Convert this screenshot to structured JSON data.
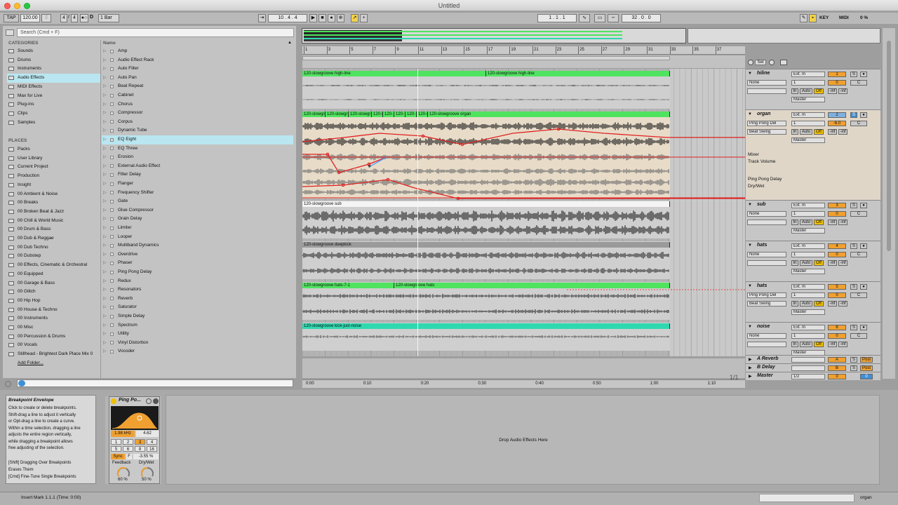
{
  "window": {
    "title": "Untitled"
  },
  "control_bar": {
    "tap": "TAP",
    "tempo": "120.00",
    "signature_num": "4",
    "signature_den": "4",
    "quantize": "1 Bar",
    "position": "10 . 4 . 4",
    "loop_start": "1 . 1 . 1",
    "loop_length": "32 . 0 . 0",
    "key": "KEY",
    "midi": "MIDI",
    "cpu": "0 %",
    "d_label": "D"
  },
  "browser": {
    "search_placeholder": "Search (Cmd + F)",
    "categories_header": "CATEGORIES",
    "categories": [
      "Sounds",
      "Drums",
      "Instruments",
      "Audio Effects",
      "MIDI Effects",
      "Max for Live",
      "Plug-ins",
      "Clips",
      "Samples"
    ],
    "places_header": "PLACES",
    "places": [
      "Packs",
      "User Library",
      "Current Project",
      "Production",
      "Insight",
      "00 Ambient & Noise",
      "00 Breaks",
      "00 Broken Beat & Jazz",
      "00 Chill & World Music",
      "00 Drum & Bass",
      "00 Dub & Reggae",
      "00 Dub Techno",
      "00 Dubstep",
      "00 Effects, Cinematic & Orchestral",
      "00 Equipped",
      "00 Garage & Bass",
      "00 Glitch",
      "00 Hip Hop",
      "00 House & Techno",
      "00 Instruments",
      "00 Misc",
      "00 Percussion & Drums",
      "00 Vocals",
      "Stillhead - Brightest Dark Place Mix 0"
    ],
    "add_folder": "Add Folder...",
    "name_header": "Name",
    "devices": [
      "Amp",
      "Audio Effect Rack",
      "Auto Filter",
      "Auto Pan",
      "Beat Repeat",
      "Cabinet",
      "Chorus",
      "Compressor",
      "Corpus",
      "Dynamic Tube",
      "EQ Eight",
      "EQ Three",
      "Erosion",
      "External Audio Effect",
      "Filter Delay",
      "Flanger",
      "Frequency Shifter",
      "Gate",
      "Glue Compressor",
      "Grain Delay",
      "Limiter",
      "Looper",
      "Multiband Dynamics",
      "Overdrive",
      "Phaser",
      "Ping Pong Delay",
      "Redux",
      "Resonators",
      "Reverb",
      "Saturator",
      "Simple Delay",
      "Spectrum",
      "Utility",
      "Vinyl Distortion",
      "Vocoder"
    ]
  },
  "ruler": {
    "bars": [
      "1",
      "3",
      "5",
      "7",
      "9",
      "11",
      "13",
      "15",
      "17",
      "19",
      "21",
      "23",
      "25",
      "27",
      "29",
      "31",
      "33",
      "35",
      "37"
    ],
    "times": [
      "0:00",
      "0:10",
      "0:20",
      "0:30",
      "0:40",
      "0:50",
      "1:00",
      "1:10"
    ],
    "set_label": "Set",
    "page": "1/1"
  },
  "clips": {
    "hiline_a": "120-slowgroove high-line",
    "hiline_b": "120-slowgroove high-line",
    "organ_short": "120-slowgro",
    "organ_short2": "120-slowgr",
    "organ_short3": "120-slowgr",
    "organ_short4": "120-s",
    "organ_short5": "120-",
    "organ_short6": "120-",
    "organ_short7": "120-",
    "organ_short8": "120-s",
    "organ_main": "120-slowgroove organ",
    "sub": "120-slowgroove sub",
    "deepkick": "120-slowgroove deepkick",
    "hats_a": "120-slowgroove hats-7-1",
    "hats_b": "120-slowgroove hats",
    "noise": "120-slowgroove kick-just-noise"
  },
  "tracks": [
    {
      "name": "hiline",
      "input": "Ext. In",
      "input_ch": "1",
      "device": "None",
      "out": "Master",
      "num": "1",
      "vol": "0",
      "pan": "C",
      "in": "In",
      "auto": "Auto",
      "off": "Off",
      "inf1": "-inf",
      "inf2": "-inf"
    },
    {
      "name": "organ",
      "input": "Ext. In",
      "input_ch": "1",
      "device": "Ping Pong Del",
      "device2": "Beat Swing",
      "out": "Master",
      "num": "2",
      "vol": "-6.0",
      "pan": "C",
      "in": "In",
      "auto": "Auto",
      "off": "Off",
      "inf1": "-inf",
      "inf2": "-inf",
      "mixer": "Mixer",
      "track_volume": "Track Volume",
      "ppd": "Ping Pong Delay",
      "drywet": "Dry/Wet"
    },
    {
      "name": "sub",
      "input": "Ext. In",
      "input_ch": "1",
      "device": "None",
      "out": "Master",
      "num": "3",
      "vol": "0",
      "pan": "C",
      "in": "In",
      "auto": "Auto",
      "off": "Off",
      "inf1": "-inf",
      "inf2": "-inf"
    },
    {
      "name": "hats",
      "input": "Ext. In",
      "input_ch": "1",
      "device": "None",
      "out": "Master",
      "num": "4",
      "vol": "0",
      "pan": "C",
      "in": "In",
      "auto": "Auto",
      "off": "Off",
      "inf1": "-inf",
      "inf2": "-inf"
    },
    {
      "name": "hats",
      "input": "Ext. In",
      "input_ch": "1",
      "device": "Ping Pong Del",
      "device2": "Beat Swing",
      "out": "Master",
      "num": "5",
      "vol": "0",
      "pan": "C",
      "in": "In",
      "auto": "Auto",
      "off": "Off",
      "inf1": "-inf",
      "inf2": "-inf"
    },
    {
      "name": "noise",
      "input": "Ext. In",
      "input_ch": "1",
      "device": "None",
      "out": "Master",
      "num": "6",
      "vol": "0",
      "pan": "C",
      "in": "In",
      "auto": "Auto",
      "off": "Off",
      "inf1": "-inf",
      "inf2": "-inf"
    }
  ],
  "returns": [
    {
      "name": "A Reverb",
      "letter": "A",
      "post": "Post"
    },
    {
      "name": "B Delay",
      "letter": "B",
      "post": "Post"
    },
    {
      "name": "Master",
      "ratio": "1/2",
      "vol": "0",
      "solo": "0"
    }
  ],
  "info": {
    "title": "Breakpoint Envelope",
    "lines": [
      "Click to create or delete breakpoints.",
      "Shift-drag a line to adjust it vertically",
      "or Opt-drag a line to create a curve.",
      "Within a time selection, dragging a line",
      "adjusts the entire region vertically,",
      "while dragging a breakpoint allows",
      "free adjusting of the selection."
    ],
    "shift_line": "[Shift] Dragging Over Breakpoints",
    "shift_line2": "Erases Them",
    "cmd_line": "[Cmd] Fine-Tune Single Breakpoints"
  },
  "device_view": {
    "name": "Ping Po...",
    "freq": "1.98 kHz",
    "q": "4.62",
    "grid": [
      "1",
      "2",
      "3",
      "4",
      "5",
      "6",
      "8",
      "16"
    ],
    "sync": "Sync",
    "f": "F",
    "offset": "-3.55 %",
    "feedback": "Feedback",
    "drywet": "Dry/Wet",
    "feedback_val": "60 %",
    "drywet_val": "50 %",
    "drop": "Drop Audio Effects Here"
  },
  "status": {
    "text": "Insert Mark 1.1.1 (Time: 0:00)",
    "track": "organ"
  },
  "colors": {
    "green_clip": "#4fe35f",
    "teal_clip": "#2fd9b0",
    "selection": "#b9e6f0",
    "orange": "#f0a030",
    "automation": "#e0201f"
  }
}
